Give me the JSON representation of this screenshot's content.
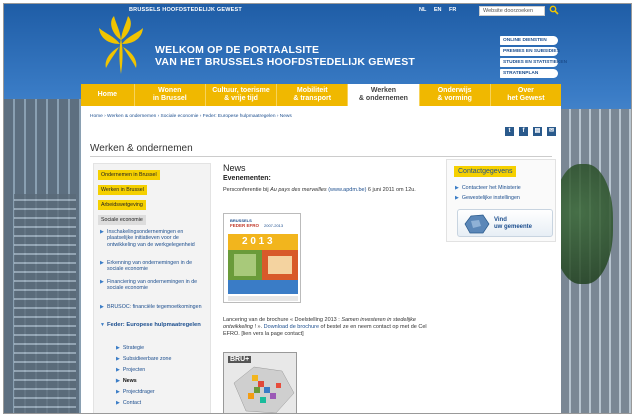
{
  "header": {
    "region_name": "BRUSSELS HOOFDSTEDELIJK GEWEST",
    "languages": [
      "NL",
      "EN",
      "FR"
    ],
    "search_placeholder": "Website doorzoeken",
    "welcome_line1": "WELKOM OP DE PORTAALSITE",
    "welcome_line2": "VAN HET BRUSSELS HOOFDSTEDELIJK GEWEST",
    "quick_links": [
      "ONLINE DIENSTEN",
      "PREMIES EN SUBSIDIES",
      "STUDIES EN STATISTIEKEN",
      "STRATENPLAN"
    ]
  },
  "nav": {
    "items": [
      {
        "line1": "Home",
        "line2": ""
      },
      {
        "line1": "Wonen",
        "line2": "in Brussel"
      },
      {
        "line1": "Cultuur, toerisme",
        "line2": "& vrije tijd"
      },
      {
        "line1": "Mobiliteit",
        "line2": "& transport"
      },
      {
        "line1": "Werken",
        "line2": "& ondernemen"
      },
      {
        "line1": "Onderwijs",
        "line2": "& vorming"
      },
      {
        "line1": "Over",
        "line2": "het Gewest"
      }
    ],
    "active_index": 4
  },
  "breadcrumb": "Home › Werken & ondernemen › Sociale economie › Feder: Europese hulpmaatregelen › News",
  "page_title": "Werken & ondernemen",
  "social": [
    "t",
    "f",
    "▤",
    "✉"
  ],
  "left_menu": {
    "boxes": [
      "Ondernemen in Brussel",
      "Werken in Brussel",
      "Arbeidswetgeving",
      "Sociale economie"
    ],
    "subitems": [
      "Inschakelingsondernemingen en plaatselijke initiatieven voor de ontwikkeling van de werkgelegenheid",
      "Erkenning van ondernemingen in de sociale economie",
      "Financiering van ondernemingen in de sociale economie",
      "BRUSOC: financiële tegemoetkomingen",
      "Feder: Europese hulpmaatregelen"
    ],
    "subsubitems": [
      "Strategie",
      "Subsidieerbare zone",
      "Projecten",
      "News",
      "Projectdrager",
      "Contact"
    ]
  },
  "main": {
    "title": "News",
    "subtitle": "Evenementen:",
    "para1_prefix": "Persconferentie bij ",
    "para1_italic": "Au pays des merveilles",
    "para1_link": "(www.apdm.be)",
    "para1_suffix": " 6 juni 2011 om 12u.",
    "brochure": {
      "line1": "BRUSSELS",
      "line2": "FEDER EFRO",
      "line3": "2007-2013",
      "year": "2 0 1 3"
    },
    "para2_prefix": "Lancering van de brochure « Doelstelling 2013 : ",
    "para2_italic": "Samen investeren in stedelijke ontwikkeling",
    "para2_mid": " ! ». ",
    "para2_link": "Download de brochure",
    "para2_suffix": " of bestel ze en neem contact op met de Cel EFRO. [lien vers la page contact]",
    "map_label": "BRU+"
  },
  "right": {
    "heading": "Contactgegevens",
    "links": [
      "Contacteer het Ministerie",
      "Gewestelijke instellingen"
    ],
    "vind_line1": "Vind",
    "vind_line2": "uw gemeente"
  },
  "colors": {
    "accent_yellow": "#f0b800",
    "link_blue": "#1c4e8e",
    "sky_blue": "#3a7cc6"
  }
}
